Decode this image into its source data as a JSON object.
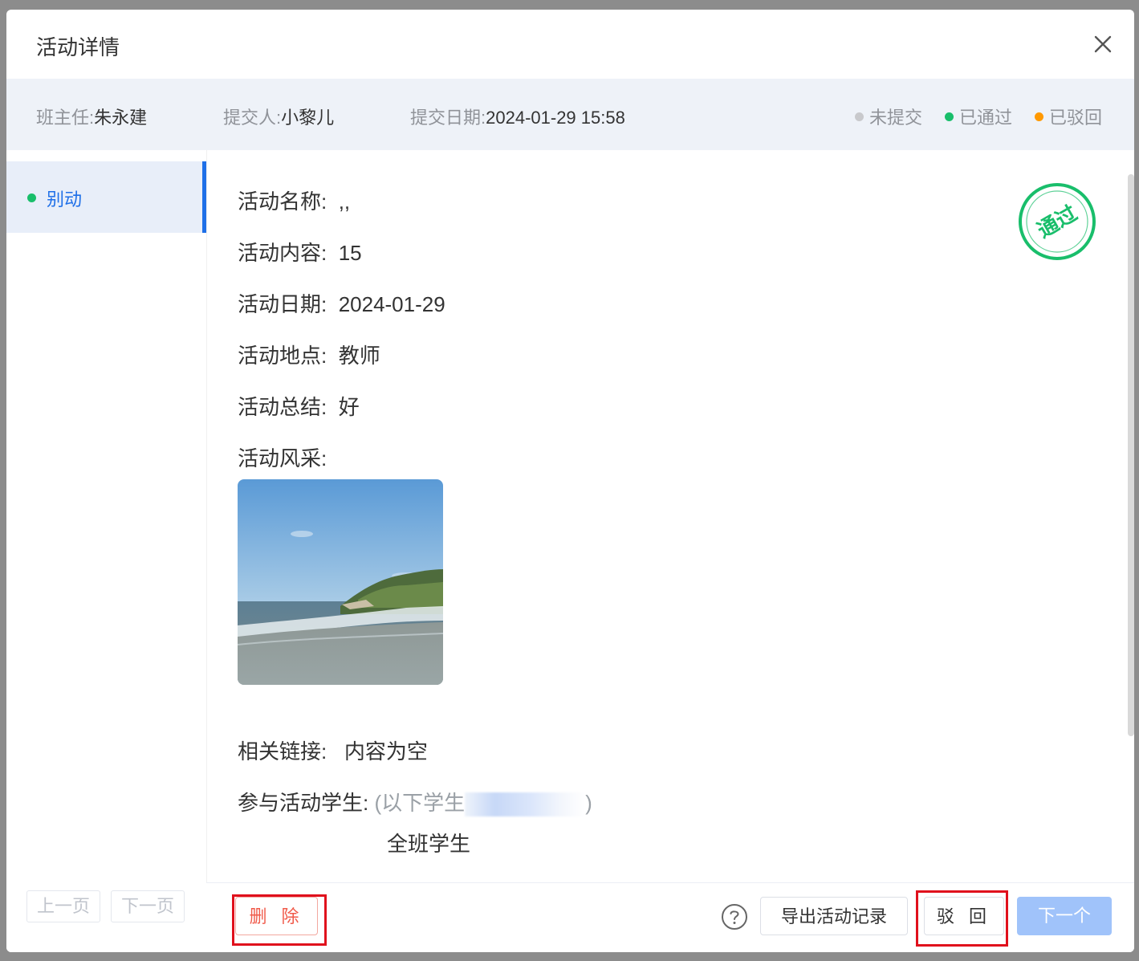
{
  "modal": {
    "title": "活动详情"
  },
  "info": {
    "teacher_label": "班主任:",
    "teacher": "朱永建",
    "submitter_label": "提交人:",
    "submitter": "小黎儿",
    "date_label": "提交日期:",
    "date": "2024-01-29 15:58"
  },
  "legend": [
    {
      "label": "未提交",
      "color": "#c8c9cc"
    },
    {
      "label": "已通过",
      "color": "#19be6b"
    },
    {
      "label": "已驳回",
      "color": "#ff9900"
    }
  ],
  "sidebar": {
    "items": [
      {
        "label": "别动",
        "status_color": "#19be6b"
      }
    ],
    "prev_page": "上一页",
    "next_page": "下一页"
  },
  "detail": {
    "name_label": "活动名称:",
    "name": ",,",
    "content_label": "活动内容:",
    "content": "15",
    "date_label": "活动日期:",
    "date": "2024-01-29",
    "place_label": "活动地点:",
    "place": "教师",
    "summary_label": "活动总结:",
    "summary": "好",
    "photos_label": "活动风采:",
    "link_label": "相关链接:",
    "link": "内容为空",
    "students_label": "参与活动学生:",
    "students_hint_open": "(以下学生",
    "students_hint_close": ")",
    "students": "全班学生",
    "stamp_text": "通过",
    "stamp_color": "#19be6b"
  },
  "footer": {
    "delete": "删 除",
    "export": "导出活动记录",
    "reject": "驳 回",
    "next": "下一个"
  },
  "colors": {
    "primary": "#1e6fe8",
    "danger": "#f05a4a",
    "success": "#19be6b",
    "warning": "#ff9900"
  }
}
